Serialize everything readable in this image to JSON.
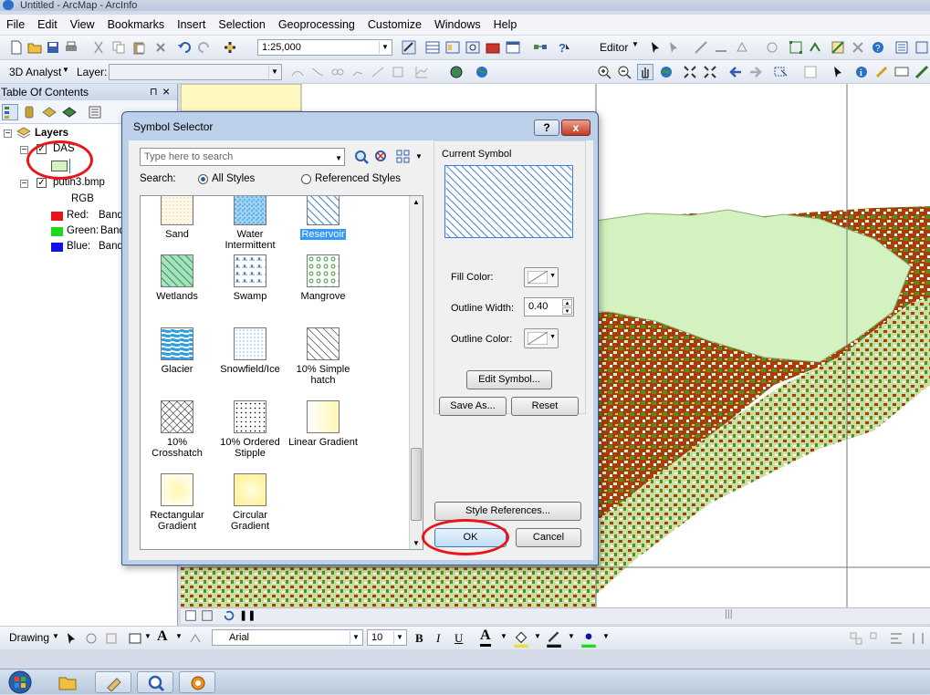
{
  "window": {
    "title": "Untitled - ArcMap - ArcInfo"
  },
  "menu": [
    "File",
    "Edit",
    "View",
    "Bookmarks",
    "Insert",
    "Selection",
    "Geoprocessing",
    "Customize",
    "Windows",
    "Help"
  ],
  "toolbar": {
    "scale": "1:25,000",
    "editor_label": "Editor"
  },
  "toolbar2": {
    "analyst_label": "3D Analyst",
    "layer_label": "Layer:"
  },
  "toc": {
    "title": "Table Of Contents",
    "pin": "ᵖ",
    "close": "×",
    "root": "Layers",
    "layers": [
      {
        "name": "DAS",
        "checked": true
      },
      {
        "name": "putih3.bmp",
        "checked": true
      }
    ],
    "rgb_label": "RGB",
    "bands": [
      {
        "label": "Red:",
        "value": "Band",
        "color": "#e8151b"
      },
      {
        "label": "Green:",
        "value": "Band",
        "color": "#1adb1a"
      },
      {
        "label": "Blue:",
        "value": "Band",
        "color": "#1010e8"
      }
    ]
  },
  "dialog": {
    "title": "Symbol Selector",
    "help": "?",
    "close": "x",
    "search_placeholder": "Type here to search",
    "search_label": "Search:",
    "opt_all": "All Styles",
    "opt_referenced": "Referenced Styles",
    "symbols": [
      {
        "name": "Sand",
        "pattern": "sand"
      },
      {
        "name": "Water Intermittent",
        "pattern": "water"
      },
      {
        "name": "Reservoir",
        "pattern": "reservoir",
        "selected": true
      },
      {
        "name": "Wetlands",
        "pattern": "wetlands"
      },
      {
        "name": "Swamp",
        "pattern": "swamp"
      },
      {
        "name": "Mangrove",
        "pattern": "mangrove"
      },
      {
        "name": "Glacier",
        "pattern": "glacier"
      },
      {
        "name": "Snowfield/Ice",
        "pattern": "snowfield"
      },
      {
        "name": "10% Simple hatch",
        "pattern": "hatch"
      },
      {
        "name": "10% Crosshatch",
        "pattern": "crosshatch"
      },
      {
        "name": "10% Ordered Stipple",
        "pattern": "stipple"
      },
      {
        "name": "Linear Gradient",
        "pattern": "lineargrad"
      },
      {
        "name": "Rectangular Gradient",
        "pattern": "rectgrad"
      },
      {
        "name": "Circular Gradient",
        "pattern": "circgrad"
      }
    ],
    "current_symbol_label": "Current Symbol",
    "fill_color_label": "Fill Color:",
    "outline_width_label": "Outline Width:",
    "outline_width_value": "0.40",
    "outline_color_label": "Outline Color:",
    "edit_symbol": "Edit Symbol...",
    "save_as": "Save As...",
    "reset": "Reset",
    "style_references": "Style References...",
    "ok": "OK",
    "cancel": "Cancel"
  },
  "drawing_toolbar": {
    "drawing_label": "Drawing",
    "font": "Arial",
    "size": "10",
    "bold": "B",
    "italic": "I",
    "underline": "U"
  },
  "colors": {
    "highlight": "#3399ff",
    "annotation_red": "#e8151b"
  }
}
